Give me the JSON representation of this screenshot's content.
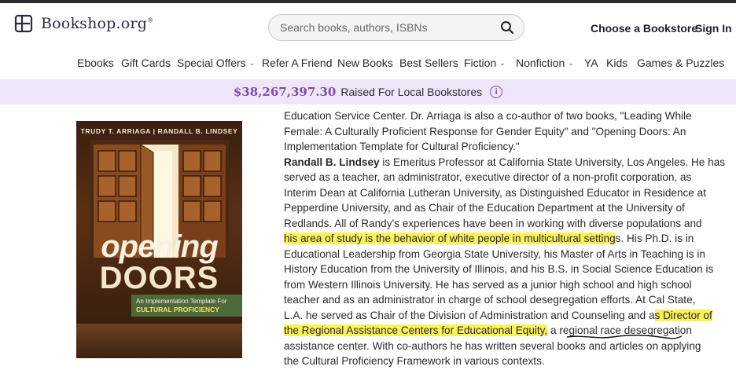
{
  "header": {
    "logo_text": "Bookshop.org",
    "logo_mark": "®",
    "search_placeholder": "Search books, authors, ISBNs",
    "choose_bookstore": "Choose a Bookstore",
    "sign_in": "Sign In"
  },
  "nav": {
    "items": [
      {
        "label": "Ebooks",
        "dropdown": false
      },
      {
        "label": "Gift Cards",
        "dropdown": false
      },
      {
        "label": "Special Offers",
        "dropdown": true
      },
      {
        "label": "Refer A Friend",
        "dropdown": false
      },
      {
        "label": "New Books",
        "dropdown": false
      },
      {
        "label": "Best Sellers",
        "dropdown": false
      },
      {
        "label": "Fiction",
        "dropdown": true
      },
      {
        "label": "Nonfiction",
        "dropdown": true
      },
      {
        "label": "YA",
        "dropdown": false
      },
      {
        "label": "Kids",
        "dropdown": false
      },
      {
        "label": "Games & Puzzles",
        "dropdown": false
      }
    ]
  },
  "banner": {
    "amount": "$38,267,397.30",
    "label": "Raised For Local Bookstores",
    "info_icon": "i"
  },
  "book": {
    "authors": "TRUDY T. ARRIAGA  |  RANDALL B. LINDSEY",
    "title_line1": "opening",
    "title_line2": "DOORS",
    "subtitle_line1": "An Implementation Template For",
    "subtitle_line2": "CULTURAL PROFICIENCY"
  },
  "bio": {
    "l1": "Education Service Center. Dr. Arriaga is also a co-author of two books, \"Leading While",
    "l2": "Female: A Culturally Proficient Response for Gender Equity\" and \"Opening Doors: An",
    "l3": "Implementation Template for Cultural Proficiency.\"",
    "l4_name": "Randall B. Lindsey",
    "l4_rest": " is Emeritus Professor at California State University, Los Angeles. He has",
    "l5": "served as a teacher, an administrator, executive director of a non-profit corporation, as",
    "l6": "Interim Dean at California Lutheran University, as Distinguished Educator in Residence at",
    "l7": "Pepperdine University, and as Chair of the Education Department at the University of",
    "l8": "Redlands. All of Randy's experiences have been in working with diverse populations and",
    "l9_hl": "his area of study is the behavior of white people in multicultural setting",
    "l9_rest": "s. His Ph.D. is in",
    "l10": "Educational Leadership from Georgia State University, his Master of Arts in Teaching is in",
    "l11": "History Education from the University of Illinois, and his B.S. in Social Science Education is",
    "l12": "from Western Illinois University. He has served as a junior high school and high school",
    "l13": "teacher and as an administrator in charge of school desegregation efforts. At Cal State,",
    "l14_a": "L.A. he served as Chair of the Division of Administration and Counseling and a",
    "l14_hl": "s Director of",
    "l15_hl": "the Regional Assistance Centers for Educational Equity,",
    "l15_rest": " a regional race desegregation",
    "l16": "assistance center. With co-authors he has written several books and articles on applying",
    "l17": "the Cultural Proficiency Framework in various contexts."
  },
  "colors": {
    "brand": "#2a2a4a",
    "banner_bg": "#efe6fa",
    "banner_amount": "#7c4dad",
    "highlight": "#fbf25a"
  }
}
